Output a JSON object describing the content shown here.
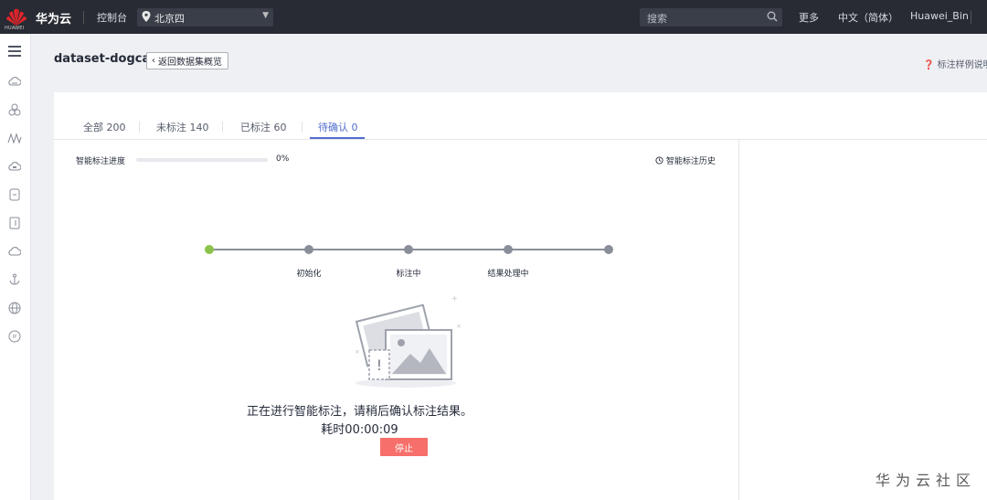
{
  "topbar": {
    "logo_text": "HUAWEI",
    "brand": "华为云",
    "console": "控制台",
    "region": "北京四",
    "search_placeholder": "搜索",
    "more": "更多",
    "language": "中文（简体）",
    "user": "Huawei_Bin"
  },
  "header": {
    "dataset_name": "dataset-dogcat",
    "back_label": "返回数据集概览",
    "help_label": "标注样例说明"
  },
  "tabs": [
    {
      "label": "全部 200"
    },
    {
      "label": "未标注 140"
    },
    {
      "label": "已标注 60"
    },
    {
      "label": "待确认 0",
      "active": true
    }
  ],
  "progress": {
    "label": "智能标注进度",
    "value": 0,
    "percent_text": "0%",
    "history_label": "智能标注历史"
  },
  "steps": [
    {
      "label": "",
      "done": true
    },
    {
      "label": "初始化",
      "done": false
    },
    {
      "label": "标注中",
      "done": false
    },
    {
      "label": "结果处理中",
      "done": false
    },
    {
      "label": "",
      "done": false
    }
  ],
  "status": {
    "message": "正在进行智能标注，请稍后确认标注结果。",
    "elapsed": "耗时00:00:09",
    "stop_label": "停止"
  },
  "watermark": "华为云社区",
  "colors": {
    "topbar": "#282b33",
    "accent": "#526ecc",
    "step_done": "#8bc34a",
    "stop_button": "#f66f6a"
  }
}
